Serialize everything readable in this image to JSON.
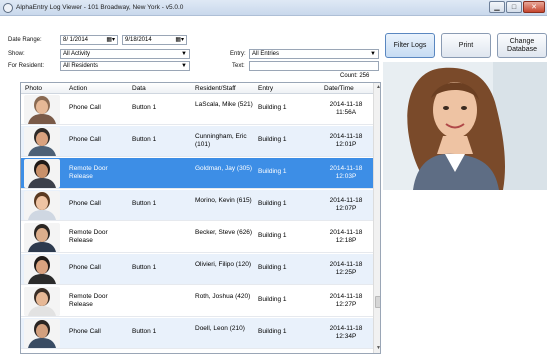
{
  "window": {
    "title": "AlphaEntry Log Viewer - 101 Broadway, New York - v5.0.0"
  },
  "filters": {
    "date_range_label": "Date Range:",
    "date_from": "8/ 1/2014",
    "date_to": "9/18/2014",
    "show_label": "Show:",
    "show_value": "All Activity",
    "entry_label": "Entry:",
    "entry_value": "All Entries",
    "resident_label": "For Resident:",
    "resident_value": "All Residents",
    "text_label": "Text:",
    "text_value": ""
  },
  "buttons": {
    "filter": "Filter Logs",
    "print": "Print",
    "change_db": "Change Database"
  },
  "count_text": "Count: 256",
  "columns": [
    "Photo",
    "Action",
    "Data",
    "Resident/Staff",
    "Entry",
    "Date/Time"
  ],
  "rows": [
    {
      "action": "Phone Call",
      "data": "Button 1",
      "resident": "LaScala, Mike (521)",
      "entry": "Building 1",
      "date": "2014-11-18",
      "time": "11:56A"
    },
    {
      "action": "Phone Call",
      "data": "Button 1",
      "resident": "Cunningham, Eric (101)",
      "entry": "Building 1",
      "date": "2014-11-18",
      "time": "12:01P"
    },
    {
      "action": "Remote Door Release",
      "data": "",
      "resident": "Goldman, Jay (305)",
      "entry": "Building 1",
      "date": "2014-11-18",
      "time": "12:03P"
    },
    {
      "action": "Phone Call",
      "data": "Button 1",
      "resident": "Morino, Kevin (615)",
      "entry": "Building 1",
      "date": "2014-11-18",
      "time": "12:07P"
    },
    {
      "action": "Remote Door Release",
      "data": "",
      "resident": "Becker, Steve (626)",
      "entry": "Building 1",
      "date": "2014-11-18",
      "time": "12:18P"
    },
    {
      "action": "Phone Call",
      "data": "Button 1",
      "resident": "Olivieri, Filipo (120)",
      "entry": "Building 1",
      "date": "2014-11-18",
      "time": "12:25P"
    },
    {
      "action": "Remote Door Release",
      "data": "",
      "resident": "Roth, Joshua (420)",
      "entry": "Building 1",
      "date": "2014-11-18",
      "time": "12:27P"
    },
    {
      "action": "Phone Call",
      "data": "Button 1",
      "resident": "Doell, Leon (210)",
      "entry": "Building 1",
      "date": "2014-11-18",
      "time": "12:34P"
    }
  ],
  "selected_row": 2,
  "icons": {
    "calendar": "calendar-icon",
    "dropdown": "chevron-down-icon"
  },
  "colors": {
    "selection": "#3d8ee6",
    "alt_row": "#e9f1fb",
    "title_bar": "#c9d8ec"
  }
}
